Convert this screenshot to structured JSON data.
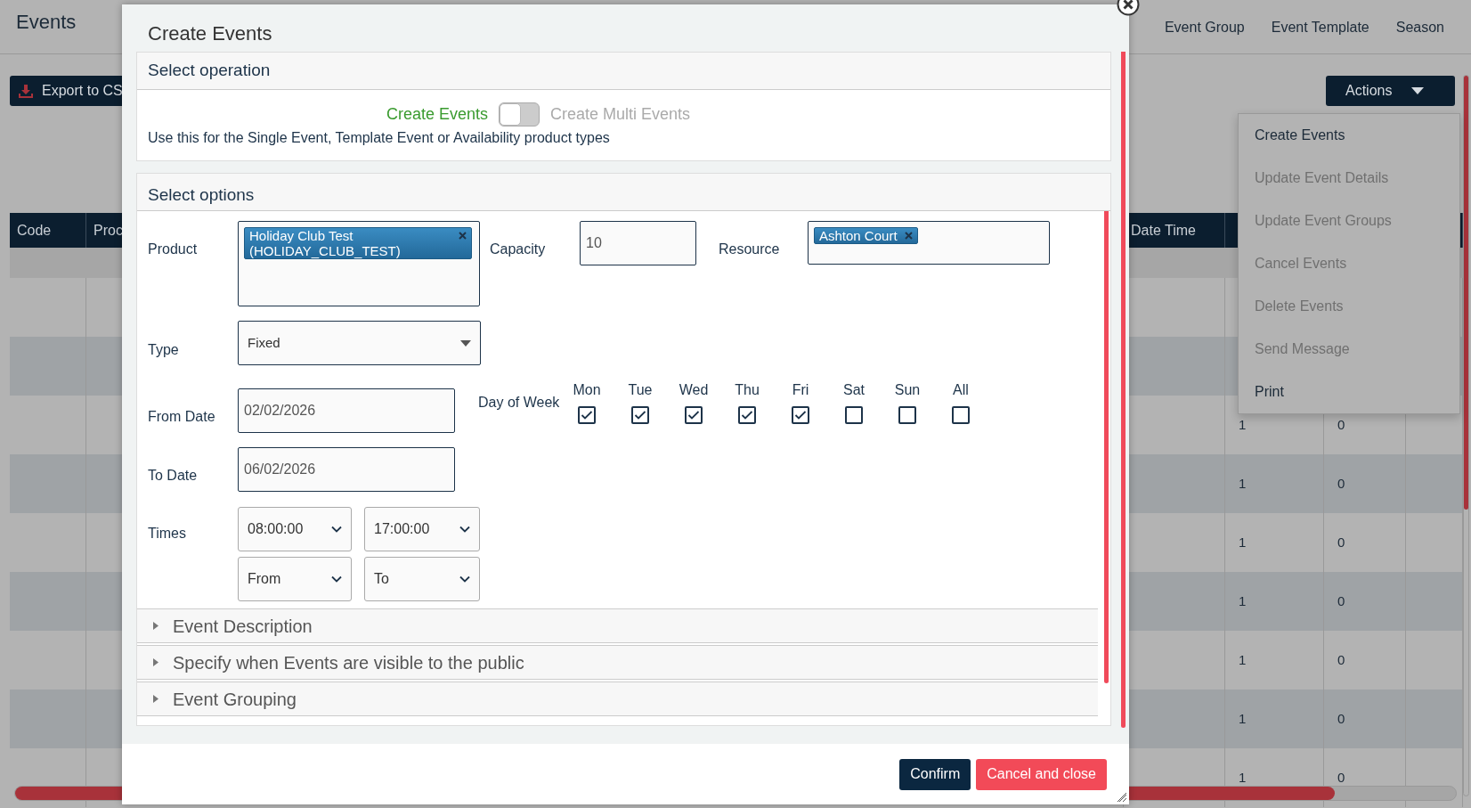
{
  "page": {
    "title": "Events",
    "tabs": [
      "Event Group",
      "Event Template",
      "Season"
    ],
    "export_button": "Export to CS",
    "actions_button": "Actions",
    "actions_menu": [
      {
        "label": "Create Events",
        "disabled": false
      },
      {
        "label": "Update Event Details",
        "disabled": true
      },
      {
        "label": "Update Event Groups",
        "disabled": true
      },
      {
        "label": "Cancel Events",
        "disabled": true
      },
      {
        "label": "Delete Events",
        "disabled": true
      },
      {
        "label": "Send Message",
        "disabled": true
      },
      {
        "label": "Print",
        "disabled": false
      }
    ],
    "table": {
      "columns": [
        "Code",
        "Proc",
        "Date Time"
      ],
      "rows": [
        {},
        {},
        {
          "cells": [
            "1",
            "0"
          ]
        },
        {
          "cells": [
            "1",
            "0"
          ]
        },
        {
          "cells": [
            "1",
            "0"
          ]
        },
        {
          "cells": [
            "1",
            "0"
          ]
        },
        {
          "cells": [
            "1",
            "0"
          ]
        },
        {
          "cells": [
            "1",
            "0"
          ]
        },
        {
          "cells": [
            "1",
            "0"
          ]
        }
      ]
    }
  },
  "dialog": {
    "title": "Create Events",
    "operation": {
      "heading": "Select operation",
      "option_left": "Create Events",
      "option_right": "Create Multi Events",
      "multi": false,
      "description": "Use this for the Single Event, Template Event or Availability product types"
    },
    "options": {
      "heading": "Select options",
      "product": {
        "label": "Product",
        "chips": [
          "Holiday Club Test (HOLIDAY_CLUB_TEST)"
        ]
      },
      "capacity": {
        "label": "Capacity",
        "value": "10"
      },
      "resource": {
        "label": "Resource",
        "chips": [
          "Ashton Court"
        ]
      },
      "type": {
        "label": "Type",
        "value": "Fixed"
      },
      "from_date": {
        "label": "From Date",
        "value": "02/02/2026"
      },
      "to_date": {
        "label": "To Date",
        "value": "06/02/2026"
      },
      "day_of_week": {
        "label": "Day of Week",
        "days": [
          {
            "label": "Mon",
            "checked": true
          },
          {
            "label": "Tue",
            "checked": true
          },
          {
            "label": "Wed",
            "checked": true
          },
          {
            "label": "Thu",
            "checked": true
          },
          {
            "label": "Fri",
            "checked": true
          },
          {
            "label": "Sat",
            "checked": false
          },
          {
            "label": "Sun",
            "checked": false
          },
          {
            "label": "All",
            "checked": false
          }
        ]
      },
      "times": {
        "label": "Times",
        "start": "08:00:00",
        "end": "17:00:00",
        "from": "From",
        "to": "To"
      }
    },
    "sections": [
      {
        "title": "Event Description",
        "expanded": false
      },
      {
        "title": "Specify when Events are visible to the public",
        "expanded": false
      },
      {
        "title": "Event Grouping",
        "expanded": false
      }
    ],
    "confirm_button": "Confirm",
    "cancel_button": "Cancel and close"
  }
}
